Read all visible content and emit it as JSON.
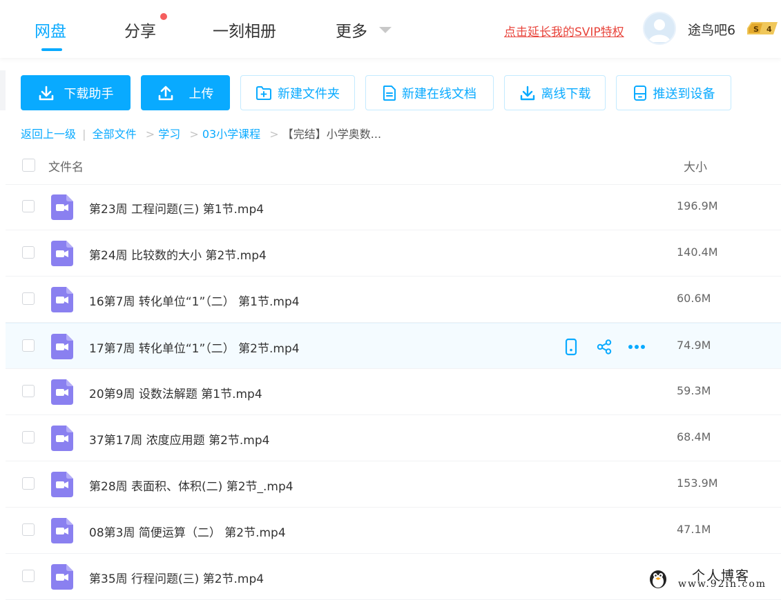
{
  "nav": {
    "tabs": [
      {
        "label": "网盘",
        "active": true
      },
      {
        "label": "分享",
        "has_dot": true
      },
      {
        "label": "一刻相册"
      },
      {
        "label": "更多",
        "has_dropdown": true
      }
    ],
    "svip_link": "点击延长我的SVIP特权",
    "username": "途鸟吧6",
    "vip_level_badge": {
      "letter": "S",
      "level": "4"
    }
  },
  "toolbar": {
    "download_helper": "下载助手",
    "upload": "上传",
    "new_folder": "新建文件夹",
    "new_online_doc": "新建在线文档",
    "offline_download": "离线下载",
    "push_to_device": "推送到设备"
  },
  "breadcrumb": {
    "back": "返回上一级",
    "divider": "|",
    "path": [
      "全部文件",
      "学习",
      "03小学课程"
    ],
    "separator": ">",
    "current": "【完结】小学奥数..."
  },
  "list": {
    "col_name": "文件名",
    "col_size": "大小",
    "files": [
      {
        "name": "第23周 工程问题(三) 第1节.mp4",
        "size": "196.9M"
      },
      {
        "name": "第24周 比较数的大小 第2节.mp4",
        "size": "140.4M"
      },
      {
        "name": "16第7周 转化单位“1”（二） 第1节.mp4",
        "size": "60.6M"
      },
      {
        "name": "17第7周 转化单位“1”（二） 第2节.mp4",
        "size": "74.9M",
        "hovered": true
      },
      {
        "name": "20第9周 设数法解题 第1节.mp4",
        "size": "59.3M"
      },
      {
        "name": "37第17周 浓度应用题 第2节.mp4",
        "size": "68.4M"
      },
      {
        "name": "第28周 表面积、体积(二) 第2节_.mp4",
        "size": "153.9M"
      },
      {
        "name": "08第3周 简便运算（二） 第2节.mp4",
        "size": "47.1M"
      },
      {
        "name": "第35周 行程问题(三) 第2节.mp4",
        "size": ""
      }
    ],
    "hover_actions": [
      "phone-icon",
      "share-icon",
      "more-icon"
    ]
  },
  "watermark": {
    "title": "个人博客",
    "url": "www.92in.com"
  },
  "colors": {
    "accent": "#09aaff",
    "video_icon": "#8a80f0",
    "svip_link": "#e8453c",
    "notification_dot": "#f55e5e"
  }
}
